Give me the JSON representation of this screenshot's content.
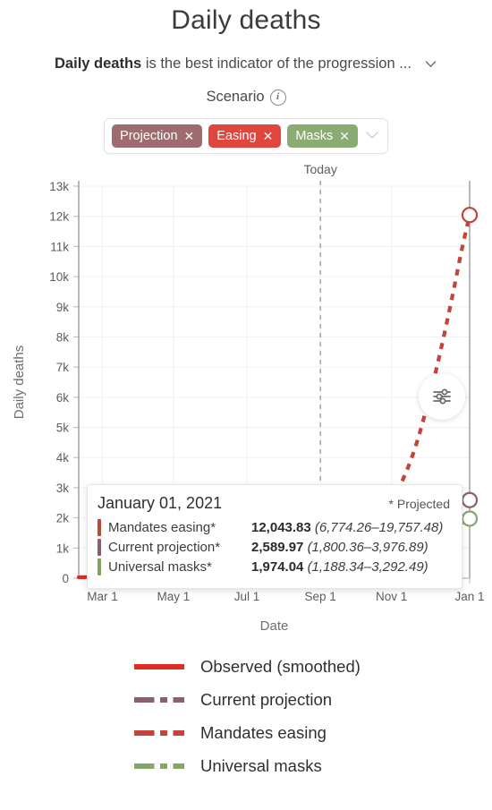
{
  "header": {
    "title": "Daily deaths",
    "subtitle_bold": "Daily deaths",
    "subtitle_rest": " is the best indicator of the progression ...",
    "expand_icon": "chevron-down-icon",
    "scenario_label": "Scenario",
    "info_icon": "i"
  },
  "chips": {
    "items": [
      {
        "label": "Projection",
        "close": "✕",
        "color": "#9d6b70"
      },
      {
        "label": "Easing",
        "close": "✕",
        "color": "#e0453e"
      },
      {
        "label": "Masks",
        "close": "✕",
        "color": "#8aab72"
      }
    ],
    "caret": "⌄"
  },
  "tooltip": {
    "date": "January 01, 2021",
    "projected_note": "* Projected",
    "rows": [
      {
        "name": "Mandates easing*",
        "value": "12,043.83",
        "ci": "(6,774.26–19,757.48)",
        "color": "#c0453c"
      },
      {
        "name": "Current projection*",
        "value": "2,589.97",
        "ci": "(1,800.36–3,976.89)",
        "color": "#8b5f67"
      },
      {
        "name": "Universal masks*",
        "value": "1,974.04",
        "ci": "(1,188.34–3,292.49)",
        "color": "#7ea362"
      }
    ]
  },
  "settings_button": {
    "icon": "sliders-icon"
  },
  "legend": {
    "items": [
      {
        "label": "Observed (smoothed)",
        "color": "#e02b20",
        "style": "solid"
      },
      {
        "label": "Current projection",
        "color": "#8b6169",
        "style": "dashed"
      },
      {
        "label": "Mandates easing",
        "color": "#c2443b",
        "style": "dashed"
      },
      {
        "label": "Universal masks",
        "color": "#85a66b",
        "style": "dashed"
      }
    ]
  },
  "chart_data": {
    "type": "line",
    "title": "Daily deaths",
    "xlabel": "Date",
    "ylabel": "Daily deaths",
    "ylim": [
      0,
      13000
    ],
    "ytick_labels": [
      "0",
      "1k",
      "2k",
      "3k",
      "4k",
      "5k",
      "6k",
      "7k",
      "8k",
      "9k",
      "10k",
      "11k",
      "12k",
      "13k"
    ],
    "ytick_values": [
      0,
      1000,
      2000,
      3000,
      4000,
      5000,
      6000,
      7000,
      8000,
      9000,
      10000,
      11000,
      12000,
      13000
    ],
    "xtick_labels": [
      "Mar 1",
      "May 1",
      "Jul 1",
      "Sep 1",
      "Nov 1",
      "Jan 1"
    ],
    "xtick_values": [
      0.0606,
      0.2424,
      0.4303,
      0.6182,
      0.8,
      1.0
    ],
    "grid": true,
    "legend_position": "bottom",
    "annotations": [
      {
        "text": "Today",
        "x": 0.6182,
        "type": "vertical-dashed-line"
      }
    ],
    "series": [
      {
        "name": "Observed (smoothed)",
        "style": "solid",
        "color": "#e02b20",
        "x": [
          0.0,
          0.02,
          0.04,
          0.055,
          0.07,
          0.085,
          0.1,
          0.115,
          0.13,
          0.145,
          0.16,
          0.175,
          0.19,
          0.21,
          0.235,
          0.265,
          0.3,
          0.34,
          0.38,
          0.42,
          0.455,
          0.49,
          0.52,
          0.55,
          0.575,
          0.6,
          0.6182
        ],
        "y": [
          30,
          35,
          40,
          50,
          70,
          130,
          330,
          750,
          1300,
          1850,
          2200,
          2330,
          2350,
          2280,
          2120,
          1880,
          1600,
          1330,
          1090,
          880,
          720,
          630,
          640,
          760,
          950,
          1050,
          900
        ]
      },
      {
        "name": "Current projection",
        "style": "dashed",
        "color": "#8b6169",
        "x": [
          0.6182,
          0.65,
          0.685,
          0.72,
          0.755,
          0.79,
          0.825,
          0.86,
          0.895,
          0.925,
          0.955,
          0.98,
          1.0
        ],
        "y": [
          900,
          950,
          1060,
          1220,
          1430,
          1700,
          2050,
          2450,
          2790,
          2930,
          2880,
          2720,
          2590
        ]
      },
      {
        "name": "Mandates easing",
        "style": "dashed",
        "color": "#c2443b",
        "x": [
          0.6182,
          0.65,
          0.685,
          0.72,
          0.755,
          0.79,
          0.825,
          0.86,
          0.895,
          0.925,
          0.955,
          0.98,
          1.0
        ],
        "y": [
          900,
          980,
          1150,
          1420,
          1800,
          2350,
          3150,
          4300,
          5900,
          7500,
          9300,
          10900,
          12044
        ]
      },
      {
        "name": "Universal masks",
        "style": "dashed",
        "color": "#85a66b",
        "x": [
          0.6182,
          0.65,
          0.685,
          0.72,
          0.755,
          0.79,
          0.825,
          0.86,
          0.895,
          0.925,
          0.955,
          0.98,
          1.0
        ],
        "y": [
          900,
          800,
          700,
          650,
          640,
          680,
          780,
          930,
          1130,
          1350,
          1600,
          1830,
          1974
        ]
      }
    ],
    "endpoint_markers": [
      {
        "series": "Mandates easing",
        "x": 1.0,
        "y": 12044,
        "color": "#c2443b"
      },
      {
        "series": "Current projection",
        "x": 1.0,
        "y": 2590,
        "color": "#8b6169"
      },
      {
        "series": "Universal masks",
        "x": 1.0,
        "y": 1974,
        "color": "#85a66b"
      }
    ]
  }
}
